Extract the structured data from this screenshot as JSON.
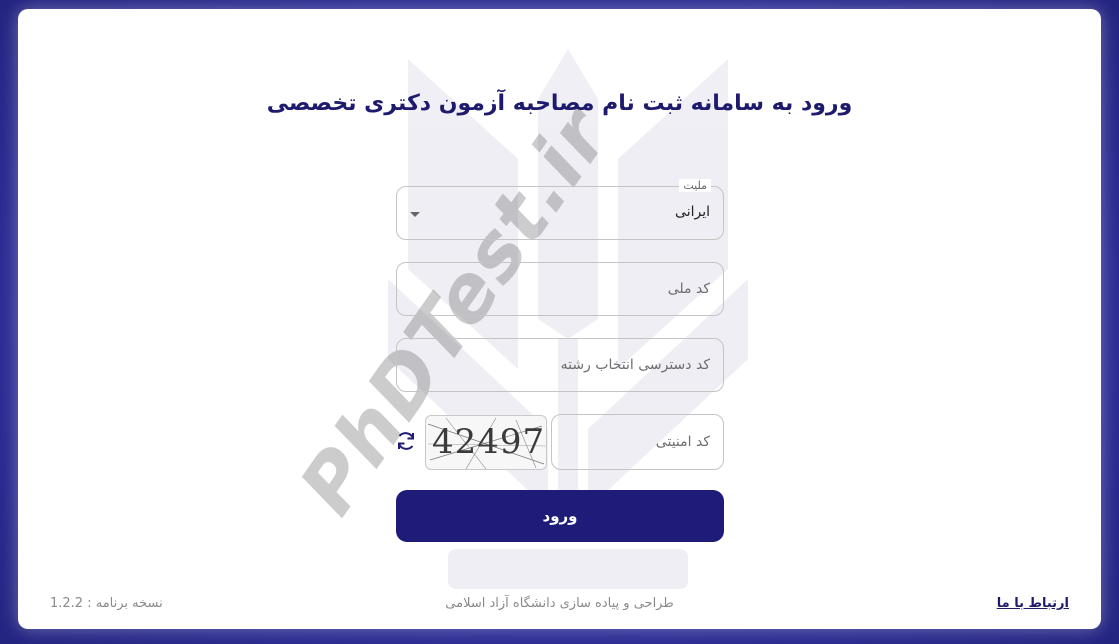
{
  "page": {
    "title": "ورود به سامانه ثبت نام مصاحبه آزمون دکتری تخصصی",
    "watermark": "PhDTest.ir"
  },
  "form": {
    "nationality": {
      "label": "ملیت",
      "value": "ایرانی"
    },
    "national_code": {
      "placeholder": "کد ملی",
      "value": ""
    },
    "access_code": {
      "placeholder": "کد دسترسی انتخاب رشته",
      "value": ""
    },
    "security_code": {
      "placeholder": "کد امنیتی",
      "value": ""
    },
    "captcha_text": "42497",
    "submit_label": "ورود"
  },
  "footer": {
    "version": "نسخه برنامه : 1.2.2",
    "credit": "طراحی و پیاده سازی دانشگاه آزاد اسلامی",
    "contact": "ارتباط با ما"
  },
  "icons": {
    "refresh": "refresh-icon",
    "dropdown": "chevron-down-icon"
  },
  "colors": {
    "brand": "#1f1b78",
    "background": "#2e2e9a",
    "title": "#1e1b6e"
  }
}
